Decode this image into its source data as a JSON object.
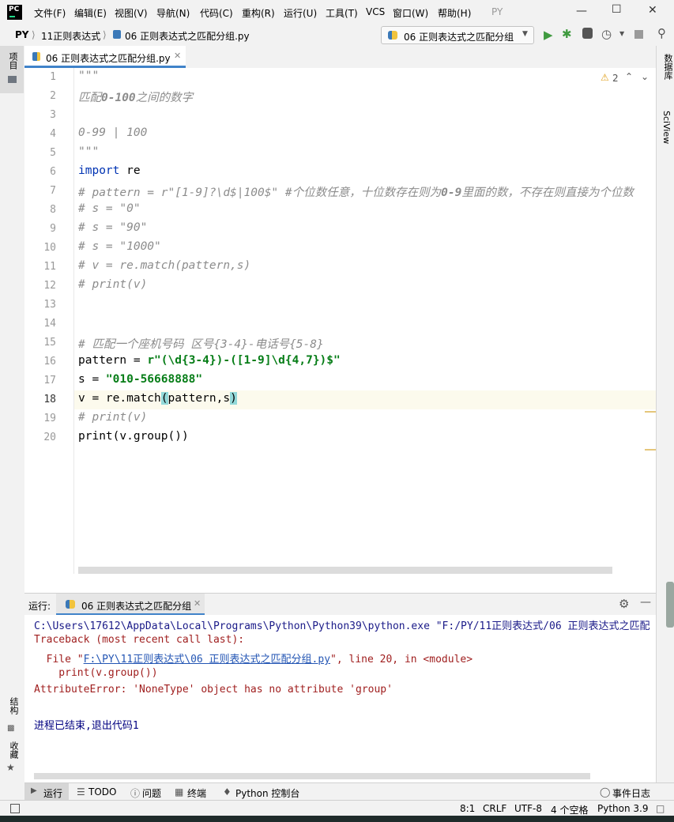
{
  "menubar": {
    "items": [
      "文件(F)",
      "编辑(E)",
      "视图(V)",
      "导航(N)",
      "代码(C)",
      "重构(R)",
      "运行(U)",
      "工具(T)",
      "VCS",
      "窗口(W)",
      "帮助(H)"
    ],
    "project_title": "PY"
  },
  "navbar": {
    "breadcrumb": [
      "PY",
      "11正则表达式",
      "06 正则表达式之匹配分组.py"
    ],
    "run_config": "06 正则表达式之匹配分组"
  },
  "left_strip": {
    "project_label": "项目",
    "structure_label": "结构",
    "favorites_label": "收藏"
  },
  "right_strip": {
    "database_label": "数据库",
    "sciview_label": "SciView"
  },
  "editor": {
    "tab_label": "06 正则表达式之匹配分组.py",
    "warning_count": "2",
    "current_line": 18
  },
  "run_panel": {
    "label": "运行:",
    "tab_label": "06 正则表达式之匹配分组",
    "console": {
      "cmd": "C:\\Users\\17612\\AppData\\Local\\Programs\\Python\\Python39\\python.exe \"F:/PY/11正则表达式/06 正则表达式之匹配",
      "traceback": "Traceback (most recent call last):",
      "file_prefix": "  File \"",
      "file_link": "F:\\PY\\11正则表达式\\06 正则表达式之匹配分组.py",
      "file_suffix": "\", line 20, in <module>",
      "code_line": "    print(v.group())",
      "error": "AttributeError: 'NoneType' object has no attribute 'group'",
      "exit": "进程已结束,退出代码1"
    }
  },
  "tool_tabs": [
    "运行",
    "TODO",
    "问题",
    "终端",
    "Python 控制台",
    "事件日志"
  ],
  "status": {
    "position": "8:1",
    "line_sep": "CRLF",
    "encoding": "UTF-8",
    "indent": "4 个空格",
    "interpreter": "Python 3.9"
  }
}
